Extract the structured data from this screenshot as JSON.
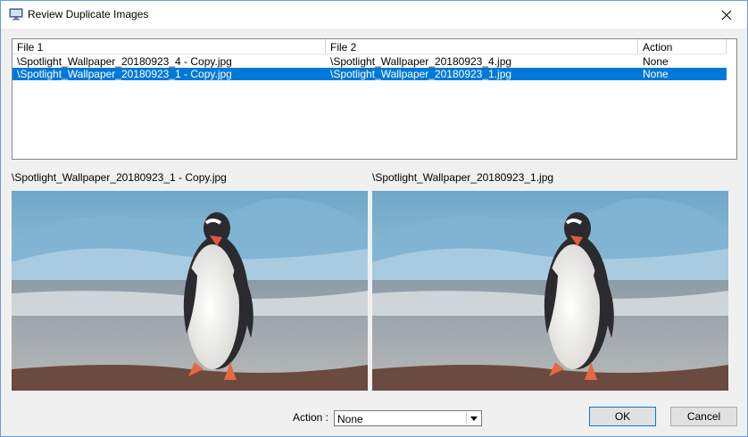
{
  "window": {
    "title": "Review Duplicate Images"
  },
  "list": {
    "columns": [
      "File 1",
      "File 2",
      "Action"
    ],
    "rows": [
      {
        "file1": "\\Spotlight_Wallpaper_20180923_4 - Copy.jpg",
        "file2": "\\Spotlight_Wallpaper_20180923_4.jpg",
        "action": "None",
        "selected": false
      },
      {
        "file1": "\\Spotlight_Wallpaper_20180923_1 - Copy.jpg",
        "file2": "\\Spotlight_Wallpaper_20180923_1.jpg",
        "action": "None",
        "selected": true
      }
    ]
  },
  "previews": {
    "left_label": "\\Spotlight_Wallpaper_20180923_1 - Copy.jpg",
    "right_label": "\\Spotlight_Wallpaper_20180923_1.jpg"
  },
  "footer": {
    "action_label": "Action :",
    "action_value": "None",
    "ok_label": "OK",
    "cancel_label": "Cancel"
  },
  "colors": {
    "selection": "#0078d7",
    "window_border": "#6e9bd5"
  },
  "icons": [
    "app-monitor-icon",
    "close-icon",
    "dropdown-arrow-icon"
  ]
}
